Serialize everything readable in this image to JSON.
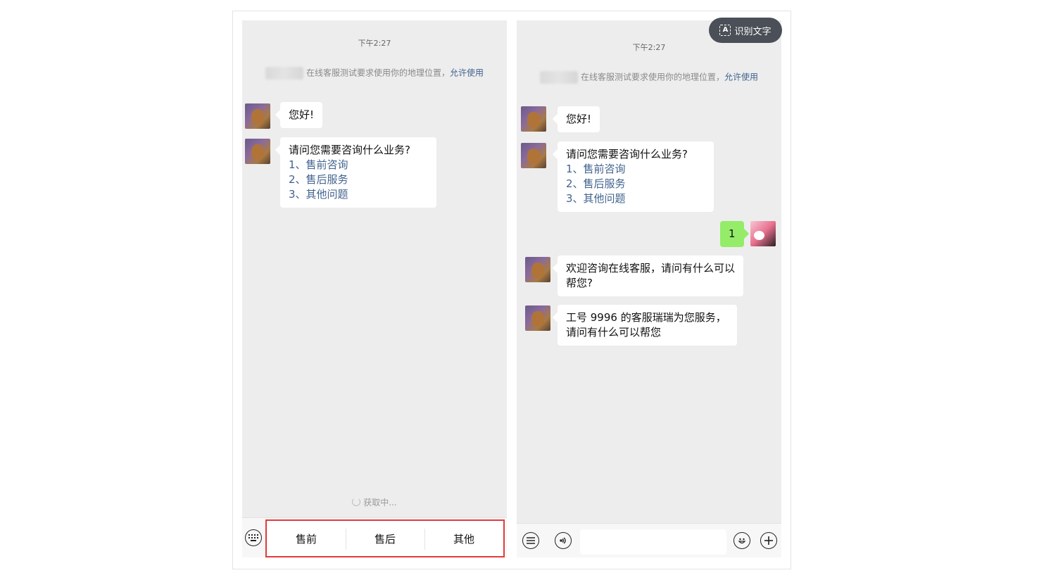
{
  "ocr": {
    "label": "识别文字",
    "icon": "text-recognition-icon"
  },
  "left": {
    "time": "下午2:27",
    "system_notice": {
      "text": "在线客服测试要求使用你的地理位置，",
      "link": "允许使用"
    },
    "messages": [
      {
        "from": "agent",
        "text": "您好!"
      },
      {
        "from": "agent",
        "text": "请问您需要咨询什么业务?",
        "options": [
          "1、售前咨询",
          "2、售后服务",
          "3、其他问题"
        ]
      }
    ],
    "loading_text": "获取中...",
    "quick_replies": [
      "售前",
      "售后",
      "其他"
    ],
    "icons": {
      "keyboard": "keyboard-icon"
    }
  },
  "right": {
    "time": "下午2:27",
    "system_notice": {
      "text": "在线客服测试要求使用你的地理位置，",
      "link": "允许使用"
    },
    "messages": [
      {
        "from": "agent",
        "text": "您好!"
      },
      {
        "from": "agent",
        "text": "请问您需要咨询什么业务?",
        "options": [
          "1、售前咨询",
          "2、售后服务",
          "3、其他问题"
        ]
      },
      {
        "from": "user",
        "text": "1"
      },
      {
        "from": "agent",
        "text": "欢迎咨询在线客服，请问有什么可以帮您?"
      },
      {
        "from": "agent",
        "text": "工号 9996 的客服瑞瑞为您服务，请问有什么可以帮您"
      }
    ],
    "input": {
      "value": "",
      "placeholder": ""
    },
    "icons": {
      "menu": "menu-list-icon",
      "voice": "voice-icon",
      "emoji": "emoji-icon",
      "plus": "plus-icon"
    }
  },
  "colors": {
    "user_bubble": "#95ec69",
    "link": "#41638f",
    "highlight_border": "#e33a3a",
    "chat_bg": "#ededed"
  }
}
